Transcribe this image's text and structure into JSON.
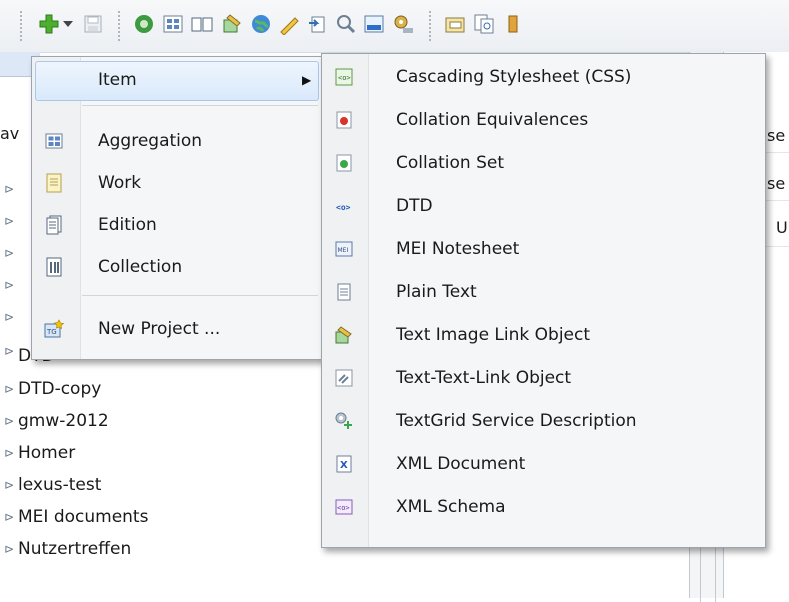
{
  "toolbar": {
    "icons": [
      "add-icon",
      "dropdown-arrow-icon",
      "save-icon",
      "refresh-icon",
      "grid-icon",
      "book-icon",
      "link-object-icon",
      "globe-icon",
      "pen-icon",
      "import-icon",
      "search-icon",
      "xml-icon",
      "settings-icon",
      "folder-icon",
      "compare-icon"
    ]
  },
  "navigator": {
    "header_label": "av",
    "tree_items": [
      "DTD",
      "DTD-copy",
      "gmw-2012",
      "Homer",
      "lexus-test",
      "MEI documents",
      "Nutzertreffen"
    ],
    "hidden_twisty_rows": 6
  },
  "right_pane": {
    "row1": "se",
    "row2": "se",
    "row3": "U"
  },
  "main_menu": {
    "items": [
      {
        "label": "Item",
        "icon": "blank-icon",
        "has_submenu": true
      },
      {
        "label": "Aggregation",
        "icon": "aggregation-icon"
      },
      {
        "label": "Work",
        "icon": "work-icon"
      },
      {
        "label": "Edition",
        "icon": "edition-icon"
      },
      {
        "label": "Collection",
        "icon": "collection-icon"
      },
      {
        "label": "New Project ...",
        "icon": "new-project-icon"
      }
    ],
    "new_project_icon_text": "TG"
  },
  "sub_menu": {
    "items": [
      {
        "label": "Cascading Stylesheet (CSS)",
        "icon": "css-icon"
      },
      {
        "label": "Collation Equivalences",
        "icon": "collation-equivalences-icon"
      },
      {
        "label": "Collation Set",
        "icon": "collation-set-icon"
      },
      {
        "label": "DTD",
        "icon": "dtd-icon"
      },
      {
        "label": "MEI Notesheet",
        "icon": "mei-icon"
      },
      {
        "label": "Plain Text",
        "icon": "plain-text-icon"
      },
      {
        "label": "Text Image Link Object",
        "icon": "text-image-link-icon"
      },
      {
        "label": "Text-Text-Link Object",
        "icon": "text-text-link-icon"
      },
      {
        "label": "TextGrid Service Description",
        "icon": "service-description-icon"
      },
      {
        "label": "XML Document",
        "icon": "xml-document-icon"
      },
      {
        "label": "XML Schema",
        "icon": "xml-schema-icon"
      }
    ],
    "mei_icon_text": "MEI",
    "xml_icon_text": "X",
    "code_icon_text": "<o>"
  }
}
